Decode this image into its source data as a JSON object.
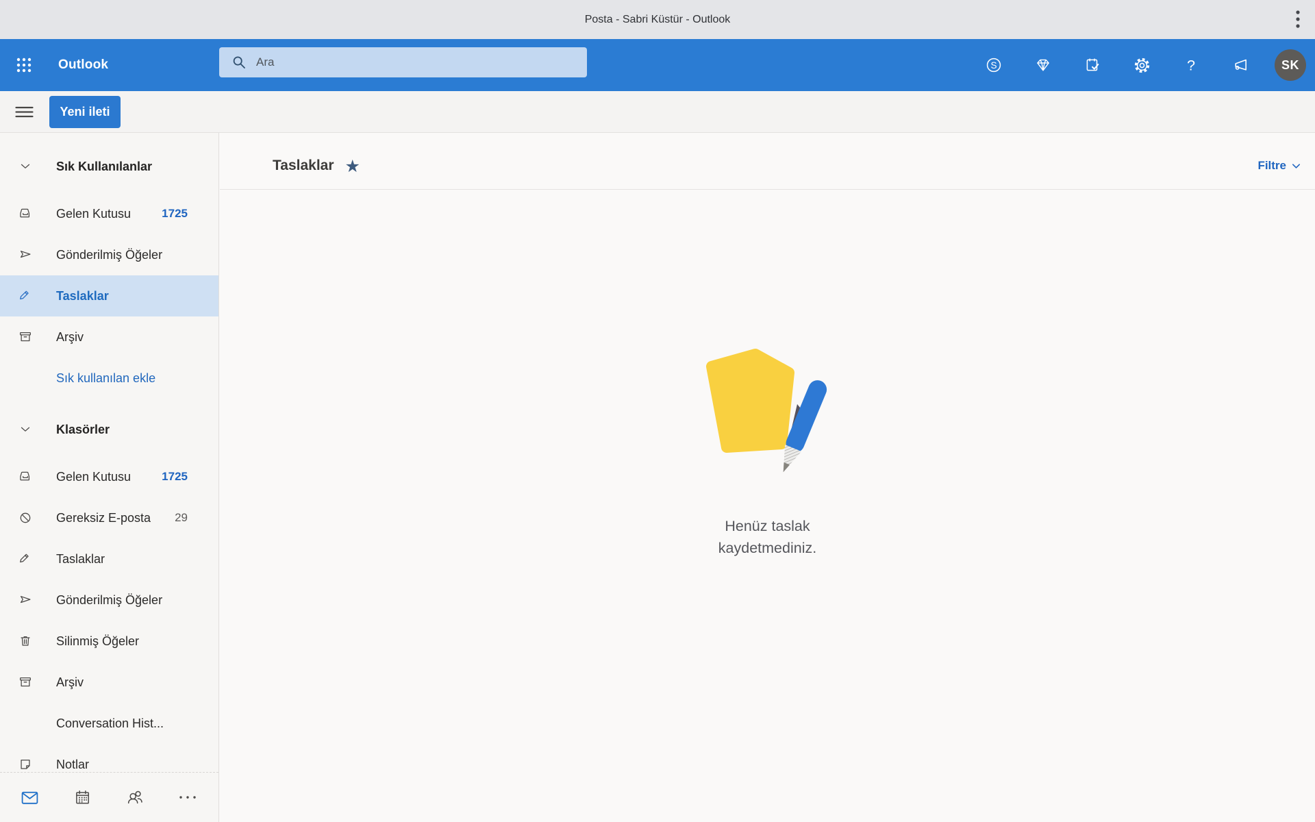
{
  "window": {
    "title": "Posta - Sabri Küstür - Outlook"
  },
  "appbar": {
    "app_name": "Outlook",
    "search_placeholder": "Ara",
    "icons": [
      "skype",
      "premium-diamond",
      "my-day-tasks",
      "settings-gear",
      "help-question",
      "feedback-megaphone"
    ],
    "avatar_initials": "SK"
  },
  "toolbar": {
    "new_message_label": "Yeni ileti"
  },
  "sidebar": {
    "sections": [
      {
        "label": "Sık Kullanılanlar",
        "items": [
          {
            "label": "Gelen Kutusu",
            "count": "1725",
            "icon": "inbox"
          },
          {
            "label": "Gönderilmiş Öğeler",
            "icon": "send"
          },
          {
            "label": "Taslaklar",
            "icon": "pencil",
            "selected": true
          },
          {
            "label": "Arşiv",
            "icon": "archive"
          },
          {
            "label": "Sık kullanılan ekle",
            "icon": "none",
            "link": true
          }
        ]
      },
      {
        "label": "Klasörler",
        "items": [
          {
            "label": "Gelen Kutusu",
            "count": "1725",
            "icon": "inbox"
          },
          {
            "label": "Gereksiz E-posta",
            "count": "29",
            "icon": "blocked"
          },
          {
            "label": "Taslaklar",
            "icon": "pencil"
          },
          {
            "label": "Gönderilmiş Öğeler",
            "icon": "send"
          },
          {
            "label": "Silinmiş Öğeler",
            "icon": "trash"
          },
          {
            "label": "Arşiv",
            "icon": "archive"
          },
          {
            "label": "Conversation Hist...",
            "icon": "none"
          },
          {
            "label": "Notlar",
            "icon": "note"
          }
        ]
      }
    ],
    "bottom_nav": [
      "mail",
      "calendar",
      "people",
      "more"
    ]
  },
  "main": {
    "heading": "Taslaklar",
    "filter_label": "Filtre",
    "empty_line1": "Henüz taslak",
    "empty_line2": "kaydetmediniz."
  },
  "colors": {
    "header_blue": "#2b7cd3",
    "button_blue": "#2b79d0",
    "search_bg": "#c3d8f1",
    "selected_bg": "#cfe0f3",
    "selected_text": "#1f6bbf",
    "count_blue": "#2065c0",
    "link_blue": "#2268bd",
    "note_yellow": "#f9d040",
    "pencil_blue": "#2e79d4"
  }
}
